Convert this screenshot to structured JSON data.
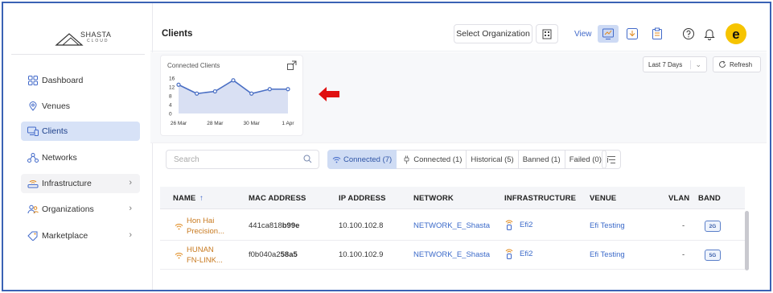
{
  "brand": {
    "name": "SHASTA",
    "sub": "CLOUD"
  },
  "sidebar": {
    "items": [
      {
        "label": "Dashboard",
        "icon": "grid-icon"
      },
      {
        "label": "Venues",
        "icon": "location-pin-icon"
      },
      {
        "label": "Clients",
        "icon": "devices-icon",
        "active": true
      },
      {
        "label": "Networks",
        "icon": "network-icon"
      },
      {
        "label": "Infrastructure",
        "icon": "router-icon",
        "chevron": true
      },
      {
        "label": "Organizations",
        "icon": "people-icon",
        "chevron": true
      },
      {
        "label": "Marketplace",
        "icon": "tag-icon",
        "chevron": true
      }
    ]
  },
  "header": {
    "title": "Clients",
    "org_select": "Select Organization",
    "view_label": "View",
    "accent": "#4169c9"
  },
  "card": {
    "title": "Connected Clients"
  },
  "chart_data": {
    "type": "area",
    "title": "Connected Clients",
    "x": [
      "26 Mar",
      "27 Mar",
      "28 Mar",
      "29 Mar",
      "30 Mar",
      "31 Mar",
      "1 Apr"
    ],
    "x_tick_labels": [
      "26 Mar",
      "28 Mar",
      "30 Mar",
      "1 Apr"
    ],
    "y_tick_labels": [
      "16",
      "12",
      "8",
      "4",
      "0"
    ],
    "series": [
      {
        "values": [
          13,
          9,
          10,
          15,
          9,
          11,
          11
        ]
      }
    ],
    "ylim": [
      0,
      16
    ],
    "color": "#4a6fc4",
    "fill": "#d9e0f3",
    "grid": false
  },
  "controls": {
    "range": "Last 7 Days",
    "refresh": "Refresh",
    "search_placeholder": "Search"
  },
  "filters": [
    {
      "label": "Connected (7)",
      "active": true
    },
    {
      "label": "Connected (1)"
    },
    {
      "label": "Historical (5)"
    },
    {
      "label": "Banned (1)"
    },
    {
      "label": "Failed (0)"
    }
  ],
  "table": {
    "columns": [
      "NAME",
      "MAC ADDRESS",
      "IP ADDRESS",
      "NETWORK",
      "INFRASTRUCTURE",
      "VENUE",
      "VLAN",
      "BAND"
    ],
    "sort_arrow": "↑",
    "rows": [
      {
        "name": "Hon Hai Precision...",
        "name_l1": "Hon Hai",
        "name_l2": "Precision...",
        "mac_prefix": "441ca818",
        "mac_suffix": "b99e",
        "ip": "10.100.102.8",
        "network": "NETWORK_E_Shasta",
        "infra": "Efi2",
        "venue": "Efi Testing",
        "vlan": "-",
        "band": "2G"
      },
      {
        "name": "HUNAN FN-LINK...",
        "name_l1": "HUNAN",
        "name_l2": "FN-LINK...",
        "mac_prefix": "f0b040a2",
        "mac_suffix": "58a5",
        "ip": "10.100.102.9",
        "network": "NETWORK_E_Shasta",
        "infra": "Efi2",
        "venue": "Efi Testing",
        "vlan": "-",
        "band": "5G"
      }
    ]
  },
  "colors": {
    "frame": "#3a62b4",
    "active_nav": "#d7e2f7",
    "link": "#3b6ac9",
    "wifi": "#e08a1e",
    "arrow": "#e01010"
  }
}
